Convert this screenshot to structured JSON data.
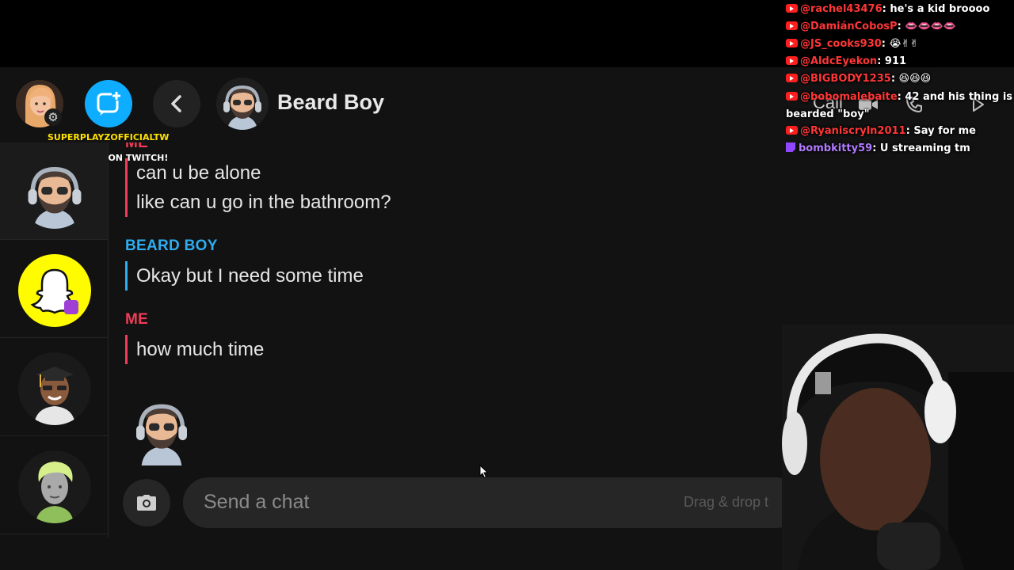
{
  "header": {
    "contact_name": "Beard Boy",
    "stream_username": "SUPERPLAYZOFFICIALTW",
    "stream_follow_text": "FOLLOWED ON TWITCH!",
    "call_label": "Call"
  },
  "icons": {
    "settings": "gear-icon",
    "new_chat": "new-chat-icon",
    "back": "chevron-left-icon",
    "video": "video-icon",
    "phone": "phone-icon",
    "camera": "camera-icon"
  },
  "messages": [
    {
      "sender": "ME",
      "lines": [
        "can u be alone",
        "like can u go in the bathroom?"
      ]
    },
    {
      "sender": "BEARD BOY",
      "lines": [
        "Okay but I need some time"
      ]
    },
    {
      "sender": "ME",
      "lines": [
        "how much time"
      ]
    }
  ],
  "composer": {
    "placeholder": "Send a chat",
    "drop_hint": "Drag & drop t"
  },
  "stream_chat": [
    {
      "platform": "youtube",
      "user": "@rachel43476",
      "text": ": he's a kid broooo"
    },
    {
      "platform": "youtube",
      "user": "@DamiánCobosP",
      "text": ": 👄👄👄👄"
    },
    {
      "platform": "youtube",
      "user": "@JS_cooks930",
      "text": ": 😭✌✌"
    },
    {
      "platform": "youtube",
      "user": "@AldcEyekon",
      "text": ": 911"
    },
    {
      "platform": "youtube",
      "user": "@BIGBODY1235",
      "text": ": 😆😆😆"
    },
    {
      "platform": "youtube",
      "user": "@bobomalebaite",
      "text": ": 42 and his thing is"
    },
    {
      "platform": "none",
      "user": "",
      "text": "bearded \"boy\""
    },
    {
      "platform": "youtube",
      "user": "@Ryaniscryln2011",
      "text": ": Say for me"
    },
    {
      "platform": "twitch",
      "user": "bombkitty59",
      "text": ": U streaming tm"
    }
  ],
  "colors": {
    "me": "#f23c57",
    "them": "#2eaef0",
    "accent": "#0fadff",
    "snap_yellow": "#fffc00"
  }
}
